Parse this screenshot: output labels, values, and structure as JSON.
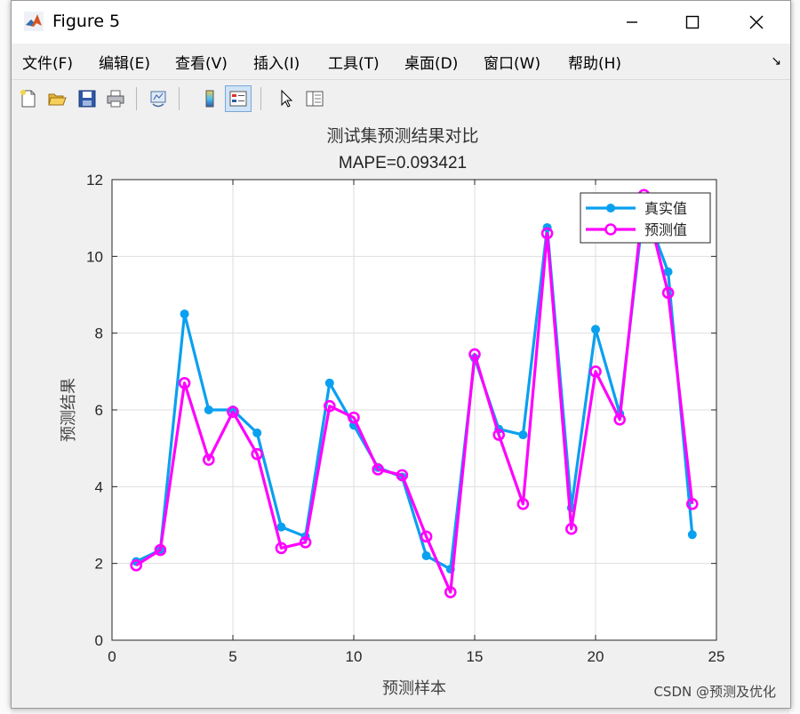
{
  "window": {
    "title": "Figure 5"
  },
  "menu": {
    "items": [
      "文件(F)",
      "编辑(E)",
      "查看(V)",
      "插入(I)",
      "工具(T)",
      "桌面(D)",
      "窗口(W)",
      "帮助(H)"
    ]
  },
  "toolbar": {
    "buttons": [
      "new-figure",
      "open-file",
      "save",
      "print",
      "link",
      "colorbar",
      "legend",
      "pointer",
      "property-inspector"
    ]
  },
  "chart_data": {
    "type": "line",
    "title": "测试集预测结果对比",
    "subtitle": "MAPE=0.093421",
    "xlabel": "预测样本",
    "ylabel": "预测结果",
    "xlim": [
      0,
      25
    ],
    "ylim": [
      0,
      12
    ],
    "xticks": [
      0,
      5,
      10,
      15,
      20,
      25
    ],
    "yticks": [
      0,
      2,
      4,
      6,
      8,
      10,
      12
    ],
    "grid": true,
    "legend_position": "top-right",
    "x": [
      1,
      2,
      3,
      4,
      5,
      6,
      7,
      8,
      9,
      10,
      11,
      12,
      13,
      14,
      15,
      16,
      17,
      18,
      19,
      20,
      21,
      22,
      23,
      24
    ],
    "series": [
      {
        "name": "真实值",
        "color": "#0aa0f0",
        "marker": "filled-circle",
        "values": [
          2.05,
          2.35,
          8.5,
          6.0,
          6.0,
          5.4,
          2.95,
          2.7,
          6.7,
          5.6,
          4.5,
          4.25,
          2.2,
          1.85,
          7.35,
          5.5,
          5.35,
          10.75,
          3.45,
          8.1,
          5.9,
          11.3,
          9.6,
          2.75
        ]
      },
      {
        "name": "预测值",
        "color": "#ff00ff",
        "marker": "open-circle",
        "values": [
          1.95,
          2.35,
          6.7,
          4.7,
          5.95,
          4.85,
          2.4,
          2.55,
          6.1,
          5.8,
          4.45,
          4.3,
          2.7,
          1.25,
          7.45,
          5.35,
          3.55,
          10.6,
          2.9,
          7.0,
          5.75,
          11.6,
          9.05,
          3.55
        ]
      }
    ]
  },
  "watermark": "CSDN @预测及优化"
}
